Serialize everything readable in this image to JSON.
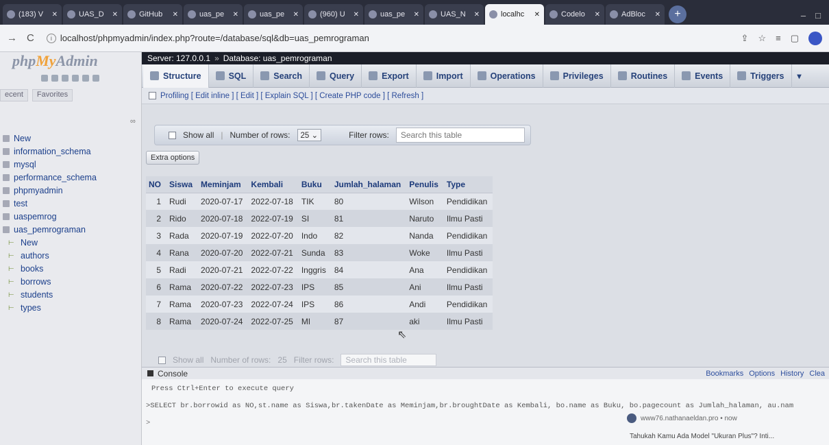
{
  "browser": {
    "tabs": [
      {
        "label": "(183) V",
        "active": false
      },
      {
        "label": "UAS_D",
        "active": false
      },
      {
        "label": "GitHub",
        "active": false
      },
      {
        "label": "uas_pe",
        "active": false
      },
      {
        "label": "uas_pe",
        "active": false
      },
      {
        "label": "(960) U",
        "active": false
      },
      {
        "label": "uas_pe",
        "active": false
      },
      {
        "label": "UAS_N",
        "active": false
      },
      {
        "label": "localhc",
        "active": true
      },
      {
        "label": "Codelo",
        "active": false
      },
      {
        "label": "AdBloc",
        "active": false
      }
    ],
    "url": "localhost/phpmyadmin/index.php?route=/database/sql&db=uas_pemrograman"
  },
  "left": {
    "logo_php": "php",
    "logo_my": "My",
    "logo_admin": "Admin",
    "tab_recent": "ecent",
    "tab_favorites": "Favorites",
    "databases": [
      {
        "label": "New",
        "level": 0
      },
      {
        "label": "information_schema",
        "level": 0
      },
      {
        "label": "mysql",
        "level": 0
      },
      {
        "label": "performance_schema",
        "level": 0
      },
      {
        "label": "phpmyadmin",
        "level": 0
      },
      {
        "label": "test",
        "level": 0
      },
      {
        "label": "uaspemrog",
        "level": 0
      },
      {
        "label": "uas_pemrograman",
        "level": 0
      },
      {
        "label": "New",
        "level": 1
      },
      {
        "label": "authors",
        "level": 1
      },
      {
        "label": "books",
        "level": 1
      },
      {
        "label": "borrows",
        "level": 1
      },
      {
        "label": "students",
        "level": 1
      },
      {
        "label": "types",
        "level": 1
      }
    ]
  },
  "breadcrumb": {
    "server": "Server: 127.0.0.1",
    "separator": "»",
    "database": "Database: uas_pemrograman"
  },
  "menu": {
    "items": [
      "Structure",
      "SQL",
      "Search",
      "Query",
      "Export",
      "Import",
      "Operations",
      "Privileges",
      "Routines",
      "Events",
      "Triggers"
    ]
  },
  "profiling": {
    "text": "Profiling [ Edit inline ] [ Edit ] [ Explain SQL ] [ Create PHP code ] [ Refresh ]"
  },
  "navigation": {
    "show_all": "Show all",
    "num_rows_label": "Number of rows:",
    "num_rows_value": "25",
    "filter_label": "Filter rows:",
    "search_placeholder": "Search this table",
    "extra_options": "Extra options"
  },
  "table": {
    "headers": [
      "NO",
      "Siswa",
      "Meminjam",
      "Kembali",
      "Buku",
      "Jumlah_halaman",
      "Penulis",
      "Type"
    ],
    "rows": [
      [
        "1",
        "Rudi",
        "2020-07-17",
        "2022-07-18",
        "TIK",
        "80",
        "Wilson",
        "Pendidikan"
      ],
      [
        "2",
        "Rido",
        "2020-07-18",
        "2022-07-19",
        "SI",
        "81",
        "Naruto",
        "Ilmu Pasti"
      ],
      [
        "3",
        "Rada",
        "2020-07-19",
        "2022-07-20",
        "Indo",
        "82",
        "Nanda",
        "Pendidikan"
      ],
      [
        "4",
        "Rana",
        "2020-07-20",
        "2022-07-21",
        "Sunda",
        "83",
        "Woke",
        "Ilmu Pasti"
      ],
      [
        "5",
        "Radi",
        "2020-07-21",
        "2022-07-22",
        "Inggris",
        "84",
        "Ana",
        "Pendidikan"
      ],
      [
        "6",
        "Rama",
        "2020-07-22",
        "2022-07-23",
        "IPS",
        "85",
        "Ani",
        "Ilmu Pasti"
      ],
      [
        "7",
        "Rama",
        "2020-07-23",
        "2022-07-24",
        "IPS",
        "86",
        "Andi",
        "Pendidikan"
      ],
      [
        "8",
        "Rama",
        "2020-07-24",
        "2022-07-25",
        "MI",
        "87",
        "aki",
        "Ilmu Pasti"
      ]
    ]
  },
  "console": {
    "title": "Console",
    "links": [
      "Bookmarks",
      "Options",
      "History",
      "Clea"
    ],
    "hint": "Press Ctrl+Enter to execute query",
    "query": ">SELECT br.borrowid as NO,st.name as Siswa,br.takenDate as Meminjam,br.broughtDate as Kembali, bo.name as Buku, bo.pagecount as Jumlah_halaman, au.nam",
    "prompt": ">",
    "notif_source": "www76.nathanaeldan.pro • now",
    "notif_text": "Tahukah Kamu Ada Model \"Ukuran Plus\"? Inti..."
  }
}
